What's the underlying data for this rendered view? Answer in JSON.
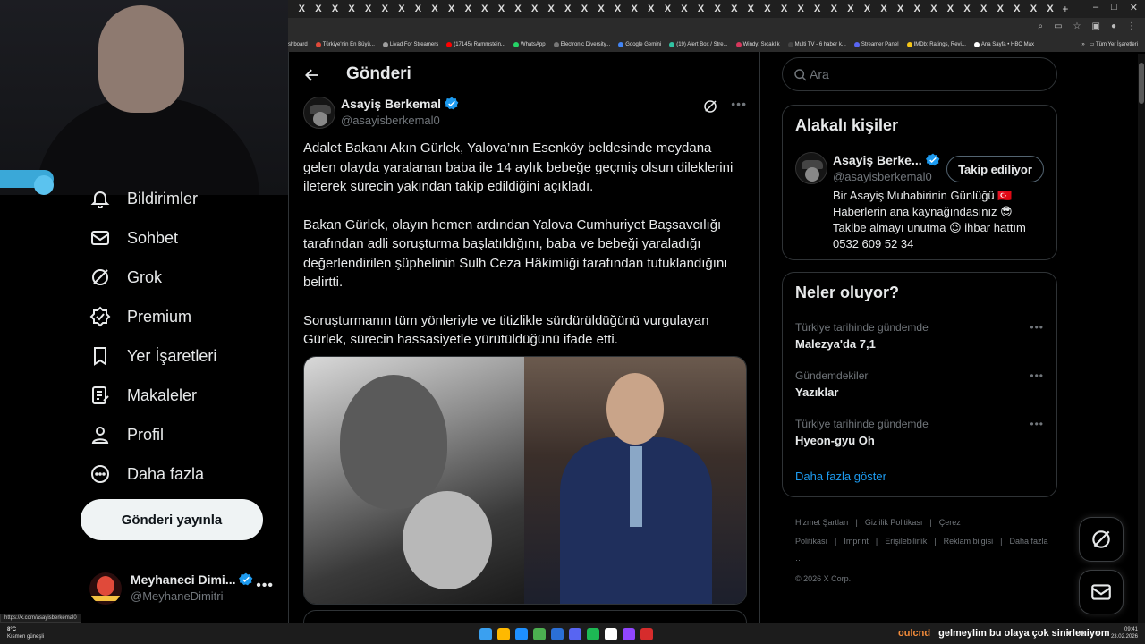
{
  "browser": {
    "tab_glyph": "X",
    "tab_count": 46,
    "new_tab": "+",
    "bookmarks": [
      {
        "label": "shboard",
        "color": "#666666"
      },
      {
        "label": "Türkiye'nin En Büyü...",
        "color": "#e04a3a"
      },
      {
        "label": "Livad For Streamers",
        "color": "#9e9e9e"
      },
      {
        "label": "(17145) Rammstein...",
        "color": "#ff0000"
      },
      {
        "label": "WhatsApp",
        "color": "#25d366"
      },
      {
        "label": "Electronic Diversity...",
        "color": "#777777"
      },
      {
        "label": "Google Gemini",
        "color": "#4285f4"
      },
      {
        "label": "(19) Alert Box / Stre...",
        "color": "#31c3a2"
      },
      {
        "label": "Windy: Sıcaklık",
        "color": "#d6375c"
      },
      {
        "label": "Multi TV - 6 haber k...",
        "color": "#444444"
      },
      {
        "label": "Streamer Panel",
        "color": "#5865f2"
      },
      {
        "label": "IMDb: Ratings, Revi...",
        "color": "#f5c518"
      },
      {
        "label": "Ana Sayfa • HBO Max",
        "color": "#ffffff"
      }
    ],
    "bookmarks_more": "»",
    "all_bookmarks": "Tüm Yer İşaretleri"
  },
  "nav": {
    "items": [
      {
        "label": "Bildirimler",
        "icon": "bell-icon"
      },
      {
        "label": "Sohbet",
        "icon": "mail-icon"
      },
      {
        "label": "Grok",
        "icon": "grok-icon"
      },
      {
        "label": "Premium",
        "icon": "premium-badge-icon"
      },
      {
        "label": "Yer İşaretleri",
        "icon": "bookmark-icon"
      },
      {
        "label": "Makaleler",
        "icon": "article-icon"
      },
      {
        "label": "Profil",
        "icon": "person-icon"
      },
      {
        "label": "Daha fazla",
        "icon": "more-circle-icon"
      }
    ],
    "post_button": "Gönderi yayınla",
    "account": {
      "name": "Meyhaneci Dimi...",
      "handle": "@MeyhaneDimitri",
      "more": "•••"
    },
    "status_url": "https://x.com/asayisberkemal0"
  },
  "main": {
    "title": "Gönderi",
    "author": {
      "name": "Asayiş Berkemal",
      "handle": "@asayisberkemal0",
      "more": "•••"
    },
    "paragraphs": [
      "Adalet Bakanı Akın Gürlek, Yalova’nın Esenköy beldesinde meydana gelen olayda yaralanan baba ile 14 aylık bebeğe geçmiş olsun dileklerini ileterek sürecin yakından takip edildiğini açıkladı.",
      "Bakan Gürlek, olayın hemen ardından Yalova Cumhuriyet Başsavcılığı tarafından adli soruşturma başlatıldığını, baba ve bebeği yaraladığı değerlendirilen şüphelinin Sulh Ceza Hâkimliği tarafından tutuklandığını belirtti.",
      "Soruşturmanın tüm yönleriyle ve titizlikle sürdürüldüğünü vurgulayan Gürlek, sürecin hassasiyetle yürütüldüğünü ifade etti."
    ]
  },
  "sidebar": {
    "search_placeholder": "Ara",
    "related": {
      "title": "Alakalı kişiler",
      "name": "Asayiş Berke...",
      "handle": "@asayisberkemal0",
      "follow": "Takip ediliyor",
      "bio": [
        "Bir Asayiş Muhabirinin Günlüğü 🇹🇷",
        "Haberlerin ana kaynağındasınız 😎",
        "Takibe almayı unutma 😉 ihbar hattım",
        "0532 609 52 34"
      ]
    },
    "trends": {
      "title": "Neler oluyor?",
      "items": [
        {
          "meta": "Türkiye tarihinde gündemde",
          "name": "Malezya'da 7,1"
        },
        {
          "meta": "Gündemdekiler",
          "name": "Yazıklar"
        },
        {
          "meta": "Türkiye tarihinde gündemde",
          "name": "Hyeon-gyu Oh"
        }
      ],
      "more_glyph": "•••",
      "show_more": "Daha fazla göster"
    },
    "footer": {
      "links": [
        "Hizmet Şartları",
        "|",
        "Gizlilik Politikası",
        "|",
        "Çerez Politikası",
        "|",
        "Imprint",
        "|",
        "Erişilebilirlik",
        "|",
        "Reklam bilgisi",
        "|",
        "Daha fazla ···"
      ],
      "copyright": "© 2026 X Corp."
    }
  },
  "taskbar": {
    "weather_temp": "8°C",
    "weather_text": "Kısmen güneşli",
    "chat_user": "oulcnd",
    "chat_msg": "gelmeylim bu olaya çok sinirleniyom",
    "time": "09:41",
    "date": "23.02.2026",
    "icon_colors": [
      "#3aa0f0",
      "#ffb900",
      "#1e90ff",
      "#4caf50",
      "#2b6fd6",
      "#5865f2",
      "#1db954",
      "#ffffff",
      "#9146ff",
      "#d62c2c"
    ]
  },
  "colors": {
    "accent": "#1d9bf0",
    "verified": "#1d9bf0",
    "text": "#e7e9ea",
    "muted": "#71767b",
    "border": "#2f3336"
  }
}
